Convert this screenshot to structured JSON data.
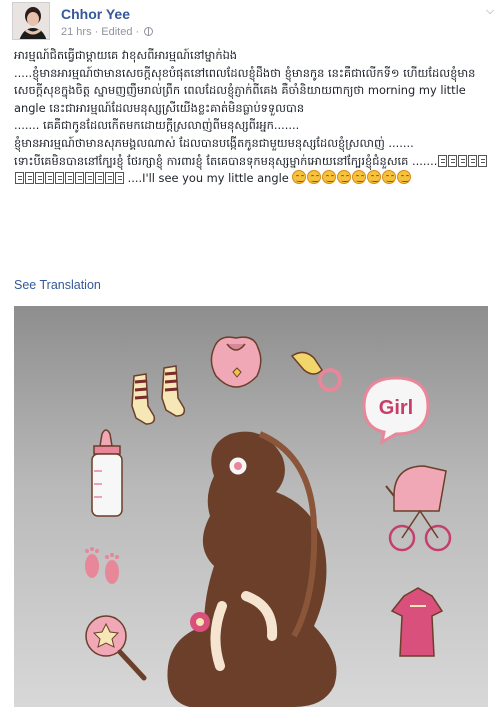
{
  "post": {
    "author": "Chhor Yee",
    "time": "21 hrs",
    "edited": "Edited",
    "privacy_icon": "globe-icon",
    "menu_icon": "chevron-down-icon",
    "lines": [
      "អារម្មណ៍ជិតធ្វើជាម្តាយគេ វាខុសពីអារម្មណ៍នៅម្នាក់ឯង",
      ".....ខ្ញុំមានអារម្មណ៍ថាមានសេចក្តីសុខបំផុតនៅពេលដែលខ្ញុំដឹងថា ខ្ញុំមានកូន នេះគឺជាលើកទី១ ហើយដែលខ្ញុំមានសេចក្តីសុខក្នុងចិត្ត ស្នាមញញឹមរាល់ព្រឹក ពេលដែលខ្ញុំភ្ញាក់ពីគេង គឺចាំនិយាយពាក្យថា morning my little angle នេះជាអារម្មណ៍ដែលមនុស្សស្រីយើងខ្លះគាត់មិនធ្លាប់ទទួលបាន",
      "....... គេគឺជាកូនដែលកើតមកដោយក្តីស្រលាញ់ពីមនុស្សពីរអ្នក.......",
      "ខ្ញុំមានអារម្មណ៍ថាមានសុភមង្គលណាស់ ដែលបានបង្កើតកូនជាមួយមនុស្សដែលខ្ញុំស្រលាញ់ .......",
      "ទោះបីគេមិនបាននៅក្បែរខ្ញុំ ថែរក្សាខ្ញុំ ការពារខ្ញុំ តែគេបានទុកមនុស្សម្នាក់អោយនៅក្បែរខ្ញុំជំនួសគេ .......",
      "....I'll see you my little angle"
    ],
    "see_translation": "See Translation"
  },
  "photo": {
    "sticker_word": "Girl"
  },
  "colors": {
    "link": "#365899",
    "meta": "#90949c",
    "text": "#1d2129",
    "pink": "#e8869a",
    "silhouette": "#6b3f2a"
  }
}
